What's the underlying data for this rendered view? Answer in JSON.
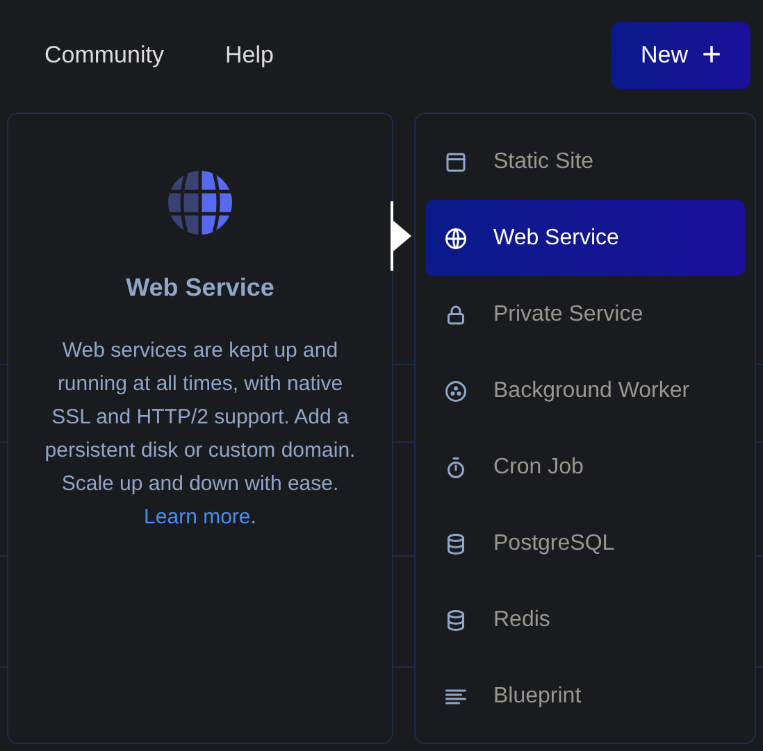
{
  "nav": {
    "links": [
      "Community",
      "Help"
    ],
    "new_button": {
      "label": "New",
      "icon": "+"
    }
  },
  "detail": {
    "title": "Web Service",
    "description": "Web services are kept up and running at all times, with native SSL and HTTP/2 support. Add a persistent disk or custom domain. Scale up and down with ease.",
    "link": "Learn more",
    "link_suffix": "."
  },
  "menu": [
    {
      "label": "Static Site",
      "kind": "window",
      "selected": false
    },
    {
      "label": "Web Service",
      "kind": "globe",
      "selected": true
    },
    {
      "label": "Private Service",
      "kind": "lock",
      "selected": false
    },
    {
      "label": "Background Worker",
      "kind": "dots",
      "selected": false
    },
    {
      "label": "Cron Job",
      "kind": "timer",
      "selected": false
    },
    {
      "label": "PostgreSQL",
      "kind": "database",
      "selected": false
    },
    {
      "label": "Redis",
      "kind": "database",
      "selected": false
    },
    {
      "label": "Blueprint",
      "kind": "lines",
      "selected": false
    }
  ]
}
